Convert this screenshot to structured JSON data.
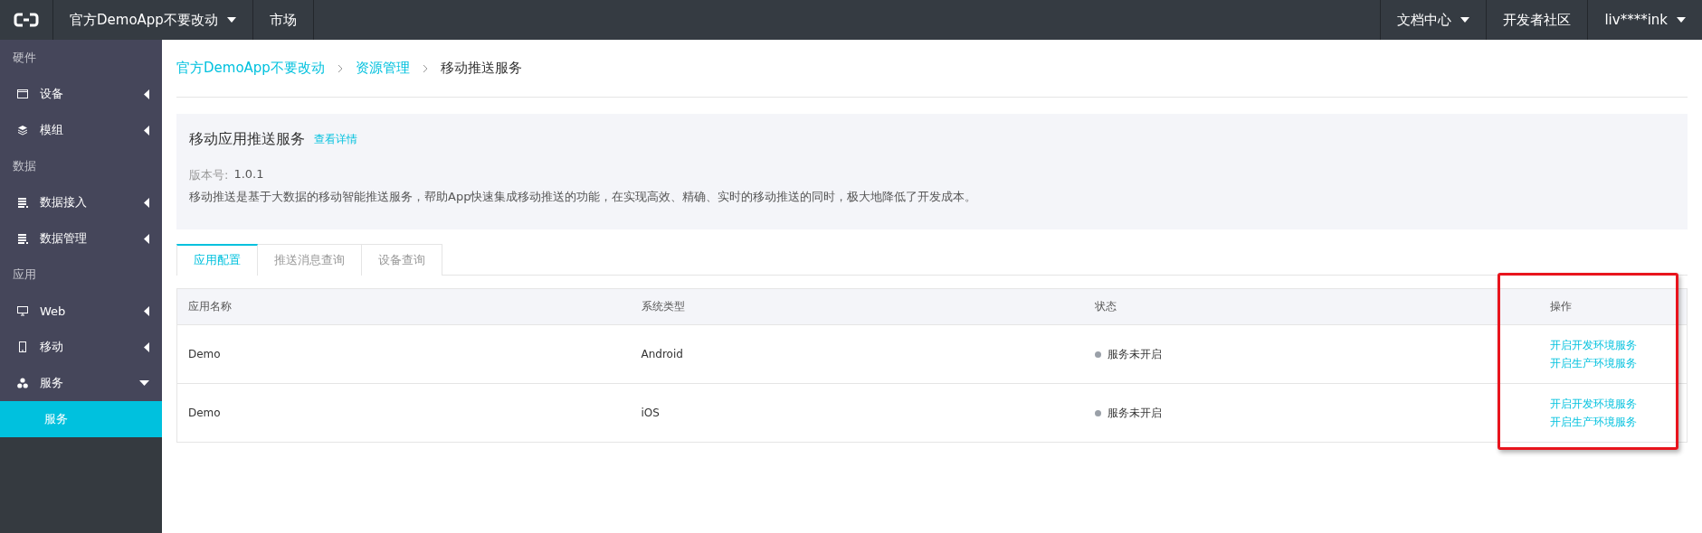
{
  "topbar": {
    "nav_left": [
      {
        "label": "官方DemoApp不要改动",
        "dropdown": true
      },
      {
        "label": "市场",
        "dropdown": false
      }
    ],
    "nav_right": [
      {
        "label": "文档中心",
        "dropdown": true
      },
      {
        "label": "开发者社区",
        "dropdown": false
      },
      {
        "label": "liv****ink",
        "dropdown": true
      }
    ]
  },
  "sidebar": {
    "sections": [
      {
        "title": "硬件",
        "items": [
          {
            "label": "设备",
            "expanded": false
          },
          {
            "label": "模组",
            "expanded": false
          }
        ]
      },
      {
        "title": "数据",
        "items": [
          {
            "label": "数据接入",
            "expanded": false
          },
          {
            "label": "数据管理",
            "expanded": false
          }
        ]
      },
      {
        "title": "应用",
        "items": [
          {
            "label": "Web",
            "expanded": false
          },
          {
            "label": "移动",
            "expanded": false
          },
          {
            "label": "服务",
            "expanded": true,
            "children": [
              {
                "label": "服务",
                "selected": true
              }
            ]
          }
        ]
      }
    ]
  },
  "breadcrumb": [
    {
      "label": "官方DemoApp不要改动",
      "current": false
    },
    {
      "label": "资源管理",
      "current": false
    },
    {
      "label": "移动推送服务",
      "current": true
    }
  ],
  "service_panel": {
    "title": "移动应用推送服务",
    "detail_link": "查看详情",
    "version_label": "版本号:",
    "version": "1.0.1",
    "description": "移动推送是基于大数据的移动智能推送服务，帮助App快速集成移动推送的功能，在实现高效、精确、实时的移动推送的同时，极大地降低了开发成本。"
  },
  "tabs": [
    {
      "label": "应用配置",
      "selected": true
    },
    {
      "label": "推送消息查询",
      "selected": false
    },
    {
      "label": "设备查询",
      "selected": false
    }
  ],
  "table": {
    "columns": [
      "应用名称",
      "系统类型",
      "状态",
      "操作"
    ],
    "rows": [
      {
        "name": "Demo",
        "system": "Android",
        "status": "服务未开启",
        "actions": [
          "开启开发环境服务",
          "开启生产环境服务"
        ]
      },
      {
        "name": "Demo",
        "system": "iOS",
        "status": "服务未开启",
        "actions": [
          "开启开发环境服务",
          "开启生产环境服务"
        ]
      }
    ]
  }
}
